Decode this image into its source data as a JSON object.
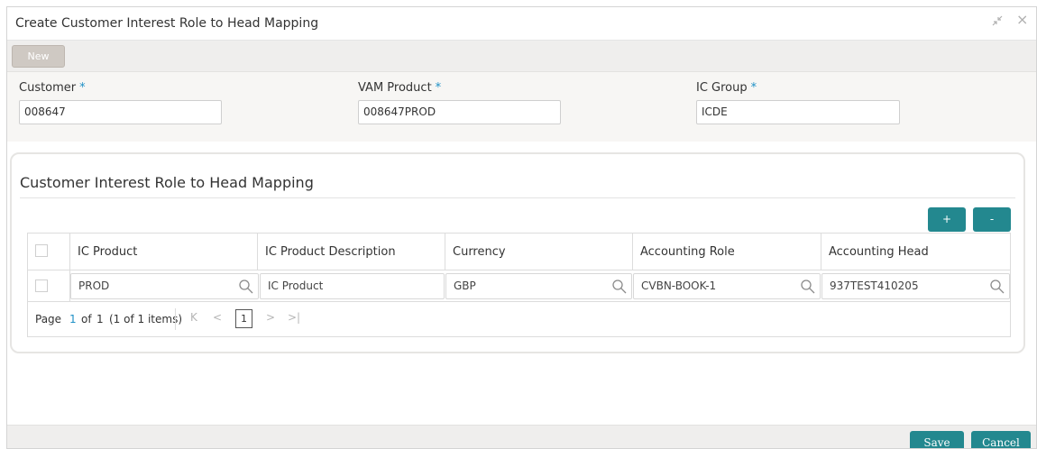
{
  "window": {
    "title": "Create Customer Interest Role to Head Mapping",
    "controls": {
      "restore_icon": "↙↗",
      "close_icon": "×"
    }
  },
  "toolbar": {
    "new_label": "New"
  },
  "form": {
    "customer": {
      "label": "Customer",
      "required_mark": "*",
      "value": "008647"
    },
    "vam_product": {
      "label": "VAM Product",
      "required_mark": "*",
      "value": "008647PROD"
    },
    "ic_group": {
      "label": "IC Group",
      "required_mark": "*",
      "value": "ICDE"
    }
  },
  "panel": {
    "title": "Customer Interest Role to Head Mapping",
    "add_label": "+",
    "remove_label": "-",
    "columns": [
      "IC Product",
      "IC Product Description",
      "Currency",
      "Accounting Role",
      "Accounting Head"
    ],
    "rows": [
      {
        "ic_product": "PROD",
        "ic_product_description": "IC Product",
        "currency": "GBP",
        "accounting_role": "CVBN-BOOK-1",
        "accounting_head": "937TEST410205"
      }
    ],
    "pager": {
      "page_label": "Page",
      "current_page": "1",
      "of_label": "of",
      "total_pages": "1",
      "items_text": "(1 of 1 items)",
      "first_icon": "K",
      "prev_icon": "<",
      "next_icon": ">",
      "last_icon": ">|",
      "page_box": "1"
    }
  },
  "footer": {
    "save_label": "Save",
    "cancel_label": "Cancel"
  },
  "colors": {
    "accent": "#23888f",
    "required": "#1e90c6",
    "toolbar_bg": "#efeeed"
  }
}
